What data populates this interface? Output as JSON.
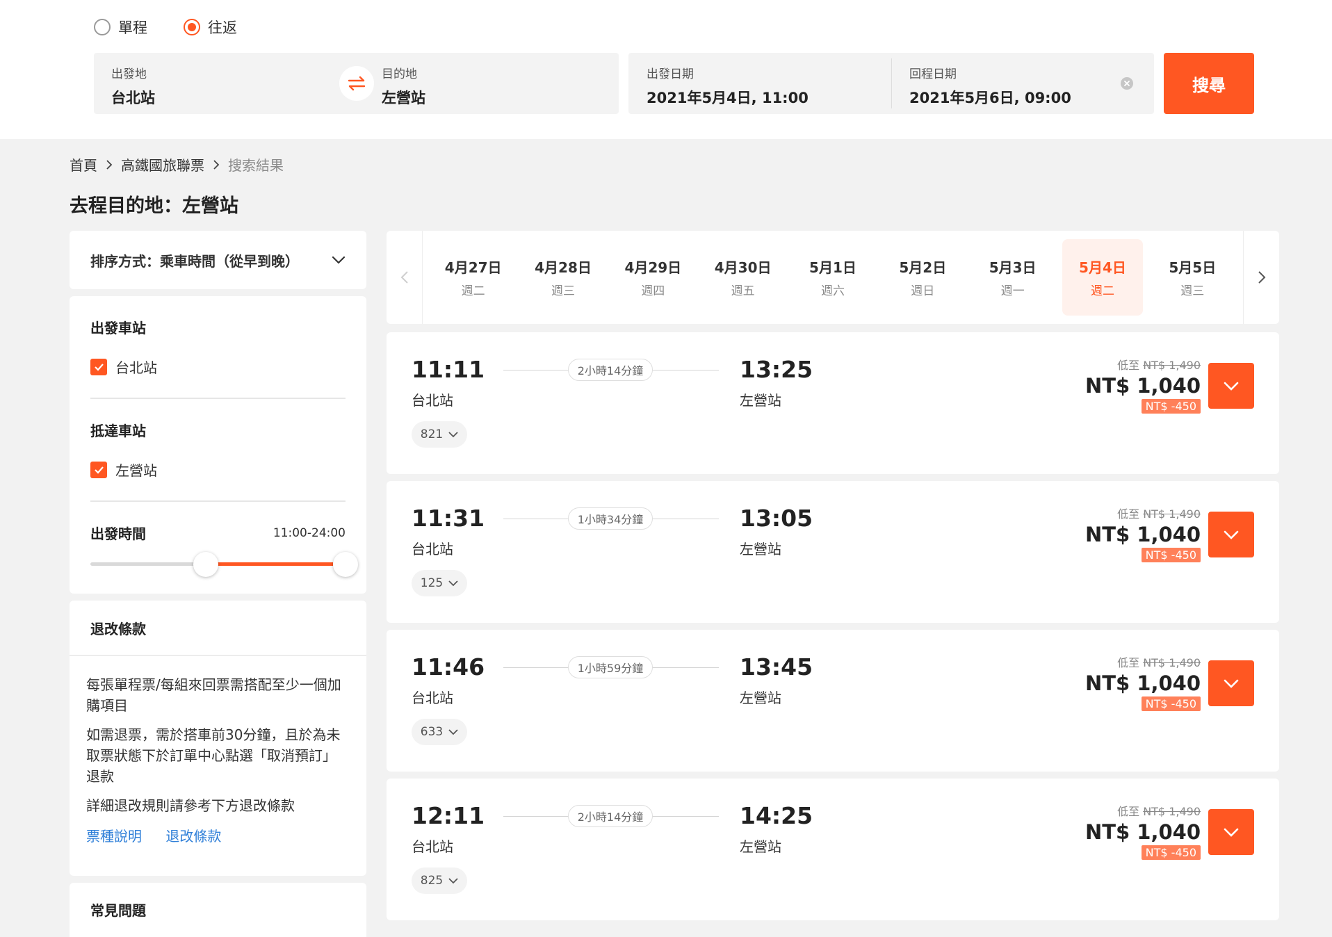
{
  "trip_type": {
    "options": [
      {
        "label": "單程",
        "selected": false
      },
      {
        "label": "往返",
        "selected": true
      }
    ]
  },
  "search": {
    "origin_label": "出發地",
    "origin_value": "台北站",
    "dest_label": "目的地",
    "dest_value": "左營站",
    "depart_label": "出發日期",
    "depart_value": "2021年5月4日, 11:00",
    "return_label": "回程日期",
    "return_value": "2021年5月6日, 09:00",
    "button": "搜尋"
  },
  "breadcrumb": [
    "首頁",
    "高鐵國旅聯票",
    "搜索結果"
  ],
  "page_title": "去程目的地：左營站",
  "sort": {
    "label": "排序方式：乘車時間（從早到晚）"
  },
  "filters": {
    "depart_station_title": "出發車站",
    "depart_station": "台北站",
    "arrive_station_title": "抵達車站",
    "arrive_station": "左營站",
    "depart_time_title": "出發時間",
    "depart_time_range": "11:00-24:00"
  },
  "refund": {
    "title": "退改條款",
    "paragraphs": [
      "每張單程票/每組來回票需搭配至少一個加購項目",
      "如需退票，需於搭車前30分鐘，且於為未取票狀態下於訂單中心點選「取消預訂」退款",
      "詳細退改規則請參考下方退改條款"
    ],
    "links": [
      "票種說明",
      "退改條款"
    ]
  },
  "faq": {
    "title": "常見問題"
  },
  "dates": [
    {
      "date": "4月27日",
      "weekday": "週二",
      "active": false
    },
    {
      "date": "4月28日",
      "weekday": "週三",
      "active": false
    },
    {
      "date": "4月29日",
      "weekday": "週四",
      "active": false
    },
    {
      "date": "4月30日",
      "weekday": "週五",
      "active": false
    },
    {
      "date": "5月1日",
      "weekday": "週六",
      "active": false
    },
    {
      "date": "5月2日",
      "weekday": "週日",
      "active": false
    },
    {
      "date": "5月3日",
      "weekday": "週一",
      "active": false
    },
    {
      "date": "5月4日",
      "weekday": "週二",
      "active": true
    },
    {
      "date": "5月5日",
      "weekday": "週三",
      "active": false
    }
  ],
  "results": [
    {
      "depart_time": "11:11",
      "depart_station": "台北站",
      "duration": "2小時14分鐘",
      "arrive_time": "13:25",
      "arrive_station": "左營站",
      "train_no": "821",
      "from_label": "低至",
      "original_price": "NT$ 1,490",
      "price": "NT$ 1,040",
      "discount": "NT$ -450"
    },
    {
      "depart_time": "11:31",
      "depart_station": "台北站",
      "duration": "1小時34分鐘",
      "arrive_time": "13:05",
      "arrive_station": "左營站",
      "train_no": "125",
      "from_label": "低至",
      "original_price": "NT$ 1,490",
      "price": "NT$ 1,040",
      "discount": "NT$ -450"
    },
    {
      "depart_time": "11:46",
      "depart_station": "台北站",
      "duration": "1小時59分鐘",
      "arrive_time": "13:45",
      "arrive_station": "左營站",
      "train_no": "633",
      "from_label": "低至",
      "original_price": "NT$ 1,490",
      "price": "NT$ 1,040",
      "discount": "NT$ -450"
    },
    {
      "depart_time": "12:11",
      "depart_station": "台北站",
      "duration": "2小時14分鐘",
      "arrive_time": "14:25",
      "arrive_station": "左營站",
      "train_no": "825",
      "from_label": "低至",
      "original_price": "NT$ 1,490",
      "price": "NT$ 1,040",
      "discount": "NT$ -450"
    }
  ],
  "colors": {
    "accent": "#ff5722",
    "link": "#2f7fd8",
    "active_date_bg": "#fff1ec"
  }
}
